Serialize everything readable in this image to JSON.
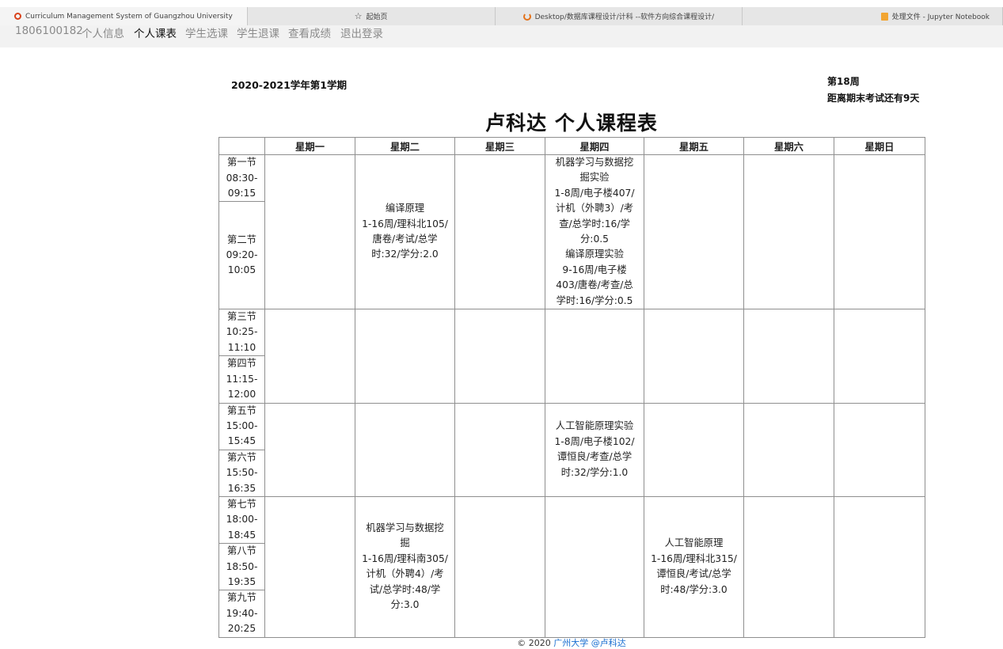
{
  "browser_tabs": [
    {
      "label": "Curriculum Management System of Guangzhou University",
      "icon": "site-logo-icon"
    },
    {
      "label": "起始页",
      "icon": "star-icon"
    },
    {
      "label": "Desktop/数据库课程设计/计科 --软件方向综合课程设计/",
      "icon": "loading-icon"
    },
    {
      "label": "处理文件 - Jupyter Notebook",
      "icon": "notebook-icon"
    }
  ],
  "nav": {
    "student_id": "1806100182",
    "items": [
      "个人信息",
      "个人课表",
      "学生选课",
      "学生退课",
      "查看成绩",
      "退出登录"
    ],
    "current": "个人课表"
  },
  "term": "2020-2021学年第1学期",
  "week": {
    "current": "第18周",
    "exam_countdown": "距离期末考试还有9天"
  },
  "title": "卢科达 个人课程表",
  "days": [
    "星期一",
    "星期二",
    "星期三",
    "星期四",
    "星期五",
    "星期六",
    "星期日"
  ],
  "periods": [
    [
      "第一节",
      "08:30-",
      "09:15"
    ],
    [
      "第二节",
      "09:20-",
      "10:05"
    ],
    [
      "第三节",
      "10:25-",
      "11:10"
    ],
    [
      "第四节",
      "11:15-",
      "12:00"
    ],
    [
      "第五节",
      "15:00-",
      "15:45"
    ],
    [
      "第六节",
      "15:50-",
      "16:35"
    ],
    [
      "第七节",
      "18:00-",
      "18:45"
    ],
    [
      "第八节",
      "18:50-",
      "19:35"
    ],
    [
      "第九节",
      "19:40-",
      "20:25"
    ]
  ],
  "courses": {
    "tue_1_2": [
      "编译原理",
      "1-16周/理科北105/",
      "唐卷/考试/总学",
      "时:32/学分:2.0"
    ],
    "thu_1_2": [
      "机器学习与数据挖",
      "掘实验",
      "1-8周/电子楼407/",
      "计机（外聘3）/考",
      "查/总学时:16/学",
      "分:0.5",
      "编译原理实验",
      "9-16周/电子楼",
      "403/唐卷/考查/总",
      "学时:16/学分:0.5"
    ],
    "thu_5_6": [
      "人工智能原理实验",
      "1-8周/电子楼102/",
      "谭恒良/考查/总学",
      "时:32/学分:1.0"
    ],
    "tue_7_9": [
      "机器学习与数据挖",
      "掘",
      "1-16周/理科南305/",
      "计机（外聘4）/考",
      "试/总学时:48/学",
      "分:3.0"
    ],
    "fri_7_9": [
      "人工智能原理",
      "1-16周/理科北315/",
      "谭恒良/考试/总学",
      "时:48/学分:3.0"
    ]
  },
  "footer": {
    "prefix": "© 2020",
    "org": "广州大学",
    "author": "@卢科达"
  }
}
